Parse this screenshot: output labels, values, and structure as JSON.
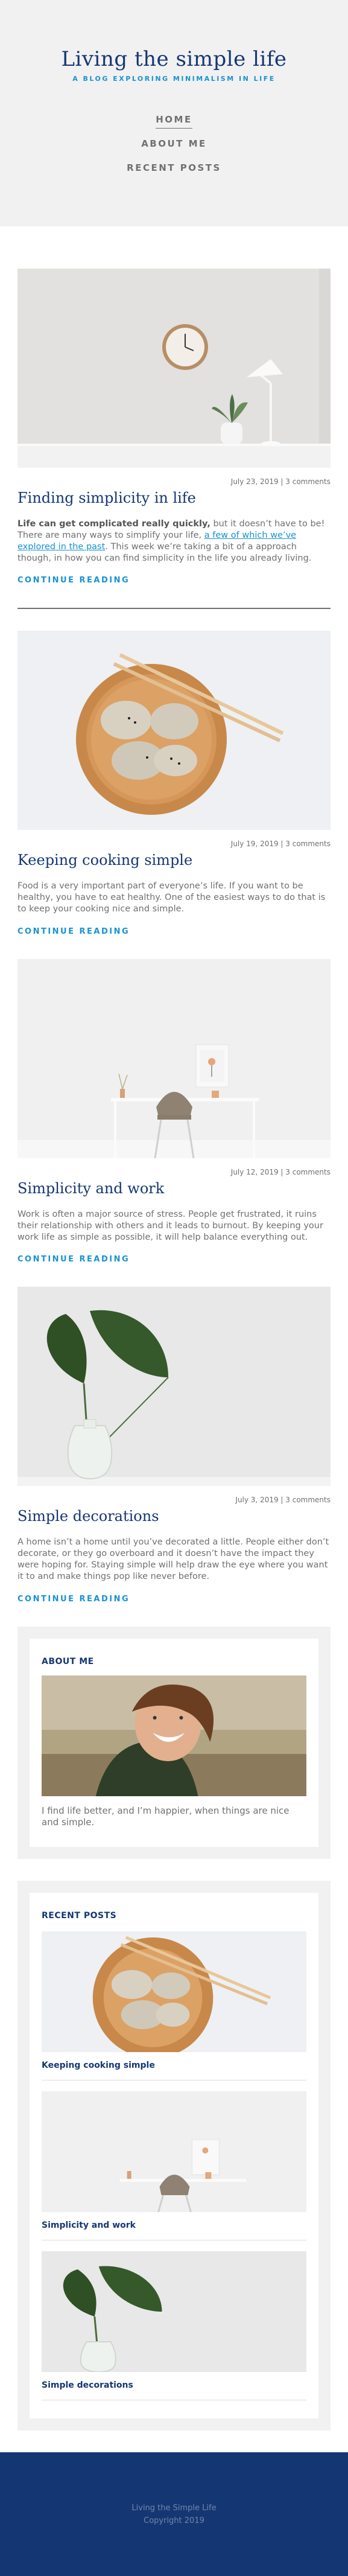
{
  "site": {
    "title": "Living the simple life",
    "tagline": "A BLOG EXPLORING MINIMALISM IN LIFE"
  },
  "nav": {
    "items": [
      {
        "label": "HOME"
      },
      {
        "label": "ABOUT ME"
      },
      {
        "label": "RECENT POSTS"
      }
    ]
  },
  "posts": [
    {
      "image": "wall-clock-and-lamp-desk",
      "meta": "July 23, 2019 | 3 comments",
      "title": "Finding simplicity in life",
      "excerpt_strong": "Life can get complicated really quickly,",
      "excerpt_pre": " but it doesn’t have to be! There are many ways to simplify your life, ",
      "excerpt_link": "a few of which we’ve explored in the past",
      "excerpt_post": ". This week we’re taking a bit of a approach though, in how you can find simplicity in the life you already living.",
      "read_more": "CONTINUE READING"
    },
    {
      "image": "dumplings-with-chopsticks",
      "meta": "July 19, 2019 | 3 comments",
      "title": "Keeping cooking simple",
      "excerpt": "Food is a very important part of everyone’s life. If you want to be healthy, you have to eat healthy. One of the easiest ways to do that is to keep your cooking nice and simple.",
      "read_more": "CONTINUE READING"
    },
    {
      "image": "white-desk-with-chair",
      "meta": "July 12, 2019 | 3 comments",
      "title": "Simplicity and work",
      "excerpt": "Work is often a major source of stress. People get frustrated, it ruins their relationship with others and it leads to burnout. By keeping your work life as simple as possible, it will help balance everything out.",
      "read_more": "CONTINUE READING"
    },
    {
      "image": "plant-in-glass-vase",
      "meta": "July 3, 2019 | 3 comments",
      "title": "Simple decorations",
      "excerpt": "A home isn’t a home until you’ve decorated a little. People either don’t decorate, or they go overboard and it doesn’t have the impact they were hoping for. Staying simple will help draw the eye where you want it to and make things pop like never before.",
      "read_more": "CONTINUE READING"
    }
  ],
  "about": {
    "title": "ABOUT ME",
    "image": "smiling-person-portrait",
    "text": "I find life better, and I’m happier, when things are nice and simple."
  },
  "recent": {
    "title": "RECENT POSTS",
    "items": [
      {
        "title": "Keeping cooking simple",
        "image": "dumplings-with-chopsticks"
      },
      {
        "title": "Simplicity and work",
        "image": "white-desk-with-chair"
      },
      {
        "title": "Simple decorations",
        "image": "plant-in-glass-vase"
      }
    ]
  },
  "footer": {
    "line1": "Living the Simple Life",
    "line2": "Copyright 2019"
  },
  "colors": {
    "brand": "#143774",
    "accent": "#1792d2",
    "text": "#707070",
    "header_bg": "#f1f1f1"
  }
}
